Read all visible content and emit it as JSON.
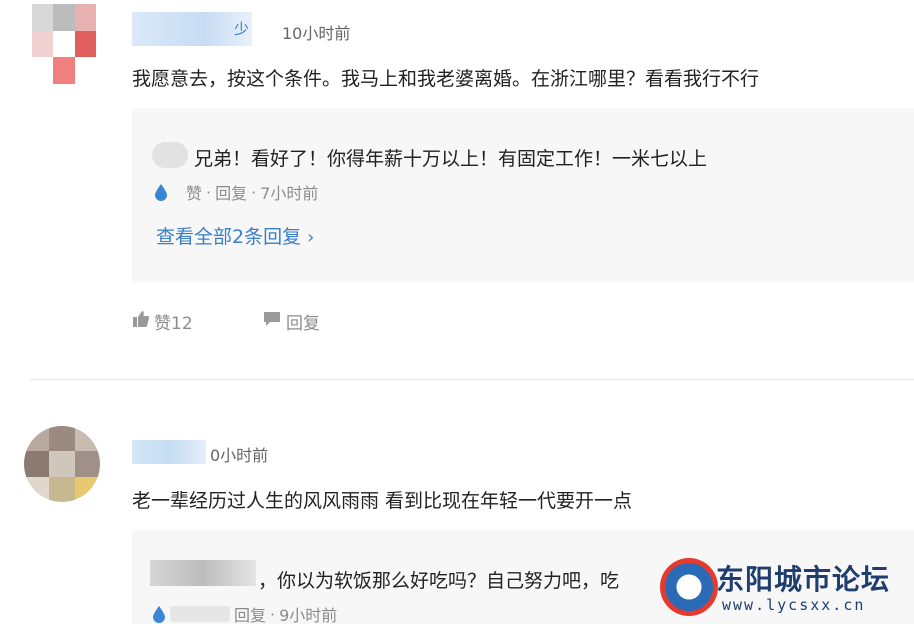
{
  "comments": [
    {
      "time": "10小时前",
      "content": "我愿意去，按这个条件。我马上和我老婆离婚。在浙江哪里？看看我行不行",
      "reply": {
        "text": "兄弟！看好了！你得年薪十万以上！有固定工作！一米七以上",
        "like_label": "赞",
        "reply_label": "回复",
        "time": "7小时前",
        "view_all": "查看全部2条回复"
      },
      "like_label": "赞12",
      "reply_label": "回复",
      "avatar_colors": [
        "#d8d8d8",
        "#bcbcbc",
        "#e8b0b0",
        "#f0d0d0",
        "#ffffff",
        "#e06060",
        "#ffffff",
        "#f08080",
        "#ffffff"
      ]
    },
    {
      "time": "0小时前",
      "content": "老一辈经历过人生的风风雨雨 看到比现在年轻一代要开一点",
      "reply": {
        "text": "，你以为软饭那么好吃吗？自己努力吧，吃",
        "reply_label": "回复",
        "time": "9小时前"
      },
      "avatar_colors": [
        "#b8aaa0",
        "#9a8a80",
        "#c8bcb0",
        "#8a7a70",
        "#d0c6bc",
        "#a09088",
        "#e0d8cc",
        "#c8b890",
        "#e8c870"
      ]
    }
  ],
  "watermark": {
    "text": "东阳城市论坛",
    "url": "www.lycsxx.cn"
  },
  "colors": {
    "link": "#3b7ec8",
    "meta": "#8c8c8c",
    "reply_bg": "#f7f7f7",
    "like_drop": "#3a86d6"
  },
  "icons": [
    "thumbs-up-icon",
    "comment-bubble-icon",
    "water-drop-like-icon",
    "chevron-right-icon"
  ]
}
